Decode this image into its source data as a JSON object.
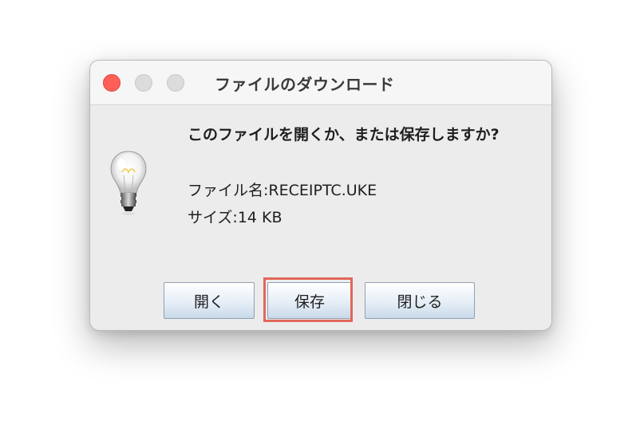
{
  "window": {
    "title": "ファイルのダウンロード"
  },
  "dialog": {
    "question": "このファイルを開くか、または保存しますか?",
    "filename": "ファイル名:RECEIPTC.UKE",
    "size": "サイズ:14 KB",
    "icon": "lightbulb-icon"
  },
  "buttons": {
    "open_label": "開く",
    "save_label": "保存",
    "close_label": "閉じる"
  },
  "colors": {
    "close_dot": "#fe5f57",
    "highlight": "#e2675a"
  }
}
